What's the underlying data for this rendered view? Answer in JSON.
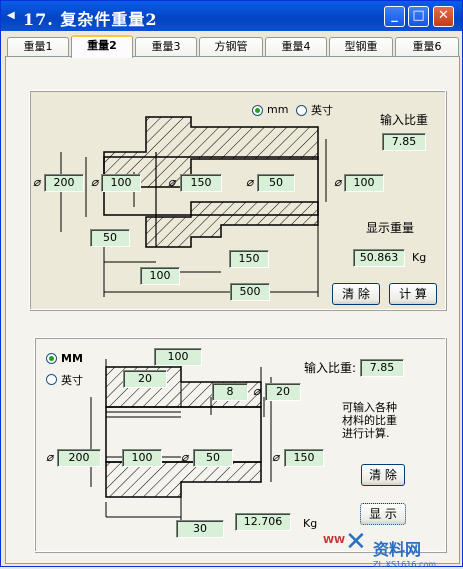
{
  "window": {
    "title": "17. 复杂件重量2",
    "app_icon": "app-icon",
    "buttons": {
      "minimize": "_",
      "maximize": "□",
      "close": "✕"
    }
  },
  "tabs": [
    "重量1",
    "重量2",
    "重量3",
    "方钢管",
    "重量4",
    "型钢重",
    "重量6"
  ],
  "active_tab": "重量2",
  "top": {
    "unit_mm": "mm",
    "unit_inch": "英寸",
    "selected_unit": "mm",
    "density_label": "输入比重",
    "density": "7.85",
    "phi": "⌀",
    "d1": "200",
    "d2": "100",
    "d3": "150",
    "d4": "50",
    "d5": "100",
    "len_a": "50",
    "len_b": "150",
    "len_c": "100",
    "len_d": "500",
    "weight_label": "显示重量",
    "weight": "50.863",
    "weight_unit": "Kg",
    "clear_label": "清 除",
    "calc_label": "计 算"
  },
  "bottom": {
    "unit_mm": "MM",
    "unit_inch": "英寸",
    "selected_unit": "MM",
    "density_label": "输入比重:",
    "density": "7.85",
    "note": [
      "可输入各种",
      "材料的比重",
      "进行计算."
    ],
    "phi": "⌀",
    "len_top": "100",
    "len_20": "20",
    "d_small": "8",
    "d_20": "20",
    "d1": "200",
    "d2": "100",
    "d3": "50",
    "d4": "150",
    "len_30": "30",
    "weight": "12.706",
    "weight_unit": "Kg",
    "clear_label": "清 除",
    "show_label": "显 示"
  },
  "watermark": {
    "text": "资料网",
    "url": "ZL.XS1616.com",
    "prefix": "WW"
  },
  "colors": {
    "field_bg": "#D8F0D8",
    "titlebar": "#0A5CE8"
  }
}
